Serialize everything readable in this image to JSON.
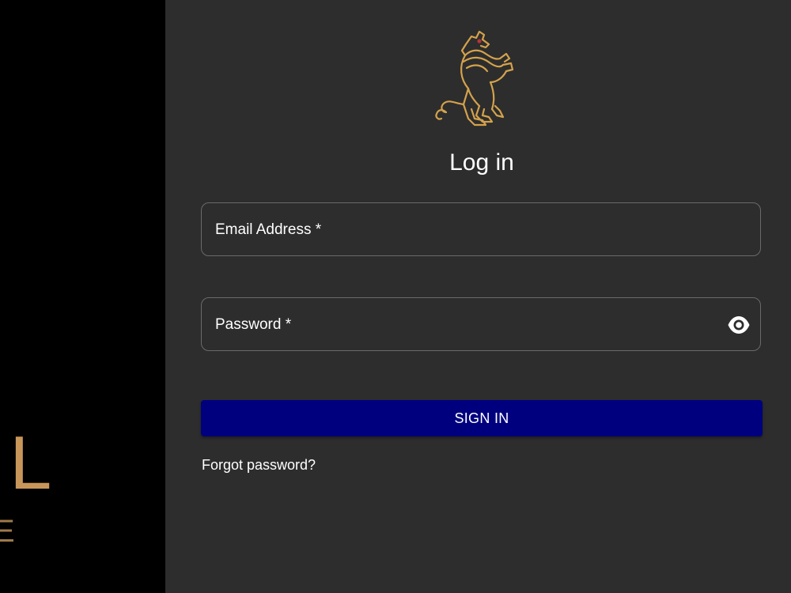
{
  "brand": {
    "left_letter_main": "L",
    "left_letter_sub": "E",
    "logo_icon": "rampant-lion-icon"
  },
  "login": {
    "title": "Log in",
    "email_label": "Email Address *",
    "password_label": "Password *",
    "password_toggle_icon": "eye-icon",
    "signin_label": "SIGN IN",
    "forgot_label": "Forgot password?"
  },
  "colors": {
    "left_panel_bg": "#000000",
    "right_panel_bg": "#2d2d2d",
    "gold": "#d4a24c",
    "button_bg": "#00007f",
    "text": "#ffffff",
    "field_border": "#6a6a6a"
  }
}
